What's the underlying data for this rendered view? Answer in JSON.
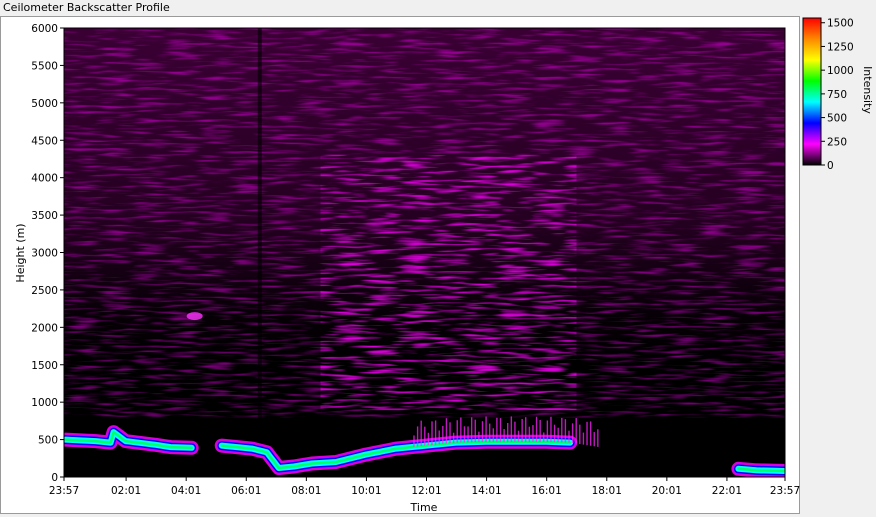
{
  "window": {
    "title": "Ceilometer Backscatter Profile"
  },
  "colors": {
    "plot_background": "#000000",
    "colorbar_stops": [
      "#000000",
      "#ff00ff",
      "#0000ff",
      "#00ffff",
      "#00ff00",
      "#ffff00",
      "#ff8800",
      "#ff0000"
    ]
  },
  "chart_data": {
    "type": "heatmap",
    "title": "Ceilometer Backscatter Profile",
    "xlabel": "Time",
    "ylabel": "Height (m)",
    "colorbar_label": "Intensity",
    "x_ticks": [
      "23:57",
      "02:01",
      "04:01",
      "06:01",
      "08:01",
      "10:01",
      "12:01",
      "14:01",
      "16:01",
      "18:01",
      "20:01",
      "22:01",
      "23:57"
    ],
    "x_tick_hours": [
      -0.05,
      2.017,
      4.017,
      6.017,
      8.017,
      10.017,
      12.017,
      14.017,
      16.017,
      18.017,
      20.017,
      22.017,
      23.95
    ],
    "xlim_hours": [
      -0.05,
      23.95
    ],
    "y_ticks": [
      0,
      500,
      1000,
      1500,
      2000,
      2500,
      3000,
      3500,
      4000,
      4500,
      5000,
      5500,
      6000
    ],
    "ylim": [
      0,
      6000
    ],
    "colorbar_ticks": [
      0,
      250,
      500,
      750,
      1000,
      1250,
      1500
    ],
    "colorbar_range": [
      0,
      1550
    ],
    "grid": false,
    "cloud_base_layer": {
      "unit": "m",
      "times_hours": [
        0.0,
        1.0,
        1.5,
        1.6,
        2.0,
        3.0,
        3.5,
        4.2,
        5.2,
        6.2,
        6.7,
        7.1,
        7.6,
        8.2,
        9.0,
        10.0,
        11.0,
        12.0,
        13.0,
        14.0,
        15.0,
        16.0,
        16.8,
        22.4,
        23.0,
        23.95
      ],
      "heights_m": [
        500,
        480,
        460,
        600,
        480,
        430,
        400,
        390,
        420,
        380,
        330,
        120,
        140,
        180,
        200,
        300,
        380,
        420,
        460,
        470,
        470,
        470,
        460,
        110,
        90,
        80
      ],
      "gaps_after_hours": [
        4.2,
        16.8
      ]
    },
    "features": {
      "elevated_aerosol_patch": {
        "time_hours": 4.3,
        "height_m": 2150,
        "intensity": 350
      },
      "upper_noise_band": {
        "start_hours": 8.5,
        "end_hours": 17.0,
        "top_m": 4300
      },
      "low_haze_top_m": 1400
    }
  }
}
